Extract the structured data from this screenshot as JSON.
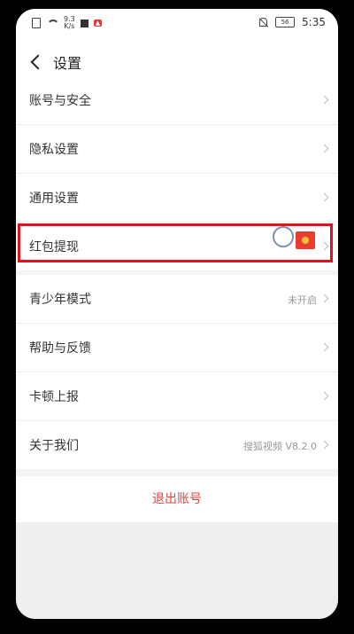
{
  "status_bar": {
    "net_speed_value": "9.3",
    "net_speed_unit": "K/s",
    "time": "5:35",
    "battery": "56"
  },
  "header": {
    "title": "设置"
  },
  "group1": [
    {
      "label": "账号与安全"
    },
    {
      "label": "隐私设置"
    },
    {
      "label": "通用设置"
    },
    {
      "label": "红包提现"
    }
  ],
  "group2": [
    {
      "label": "青少年模式",
      "value": "未开启"
    },
    {
      "label": "帮助与反馈"
    },
    {
      "label": "卡顿上报"
    },
    {
      "label": "关于我们",
      "value": "搜狐视频 V8.2.0"
    }
  ],
  "logout_label": "退出账号",
  "colors": {
    "accent": "#e0463c",
    "highlight": "#e0141e"
  }
}
